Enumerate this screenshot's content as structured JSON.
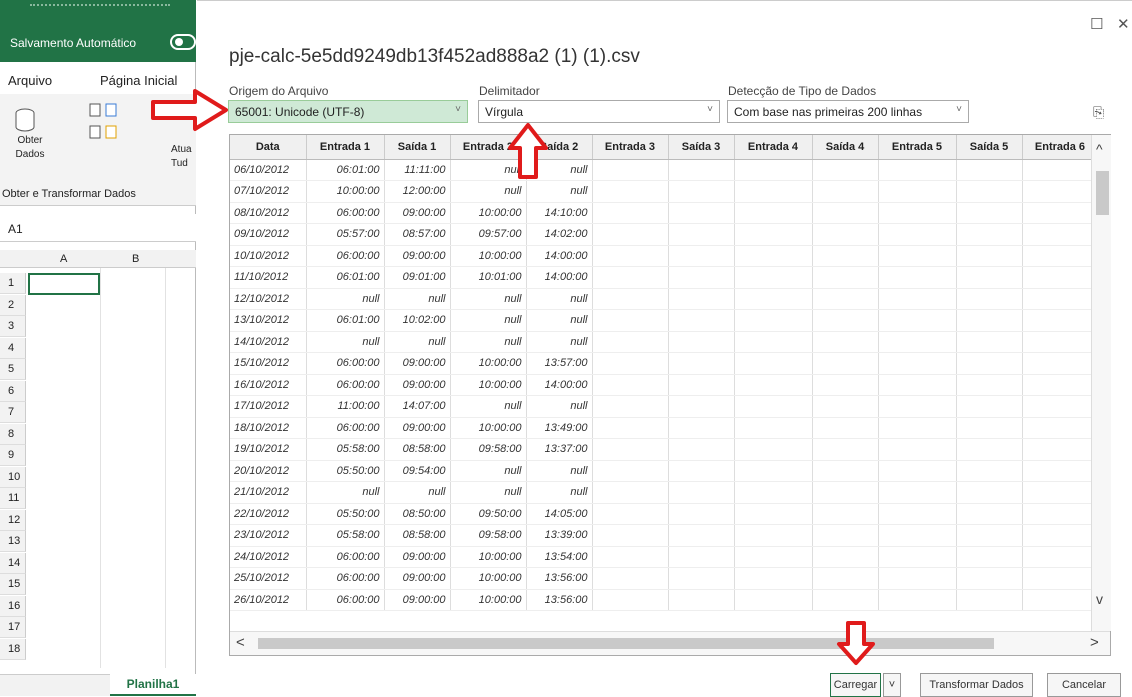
{
  "excel": {
    "autosave": "Salvamento Automático",
    "tabs": [
      "Arquivo",
      "Página Inicial"
    ],
    "obter_label": "Obter Dados",
    "atua_label": "Atua Tud",
    "group_label": "Obter e Transformar Dados",
    "name_box": "A1",
    "columns": [
      "A",
      "B"
    ],
    "rows": [
      "1",
      "2",
      "3",
      "4",
      "5",
      "6",
      "7",
      "8",
      "9",
      "10",
      "11",
      "12",
      "13",
      "14",
      "15",
      "16",
      "17",
      "18"
    ],
    "sheet": "Planilha1"
  },
  "dialog": {
    "title": "pje-calc-5e5dd9249db13f452ad888a2 (1) (1).csv",
    "origem_label": "Origem do Arquivo",
    "origem_value": "65001: Unicode (UTF-8)",
    "delim_label": "Delimitador",
    "delim_value": "Vírgula",
    "tipo_label": "Detecção de Tipo de Dados",
    "tipo_value": "Com base nas primeiras 200 linhas",
    "buttons": {
      "carregar": "Carregar",
      "transformar": "Transformar Dados",
      "cancelar": "Cancelar"
    }
  },
  "table": {
    "headers": [
      "Data",
      "Entrada 1",
      "Saída 1",
      "Entrada 2",
      "Saída 2",
      "Entrada 3",
      "Saída 3",
      "Entrada 4",
      "Saída 4",
      "Entrada 5",
      "Saída 5",
      "Entrada 6"
    ],
    "rows": [
      [
        "06/10/2012",
        "06:01:00",
        "11:11:00",
        "null",
        "null"
      ],
      [
        "07/10/2012",
        "10:00:00",
        "12:00:00",
        "null",
        "null"
      ],
      [
        "08/10/2012",
        "06:00:00",
        "09:00:00",
        "10:00:00",
        "14:10:00"
      ],
      [
        "09/10/2012",
        "05:57:00",
        "08:57:00",
        "09:57:00",
        "14:02:00"
      ],
      [
        "10/10/2012",
        "06:00:00",
        "09:00:00",
        "10:00:00",
        "14:00:00"
      ],
      [
        "11/10/2012",
        "06:01:00",
        "09:01:00",
        "10:01:00",
        "14:00:00"
      ],
      [
        "12/10/2012",
        "null",
        "null",
        "null",
        "null"
      ],
      [
        "13/10/2012",
        "06:01:00",
        "10:02:00",
        "null",
        "null"
      ],
      [
        "14/10/2012",
        "null",
        "null",
        "null",
        "null"
      ],
      [
        "15/10/2012",
        "06:00:00",
        "09:00:00",
        "10:00:00",
        "13:57:00"
      ],
      [
        "16/10/2012",
        "06:00:00",
        "09:00:00",
        "10:00:00",
        "14:00:00"
      ],
      [
        "17/10/2012",
        "11:00:00",
        "14:07:00",
        "null",
        "null"
      ],
      [
        "18/10/2012",
        "06:00:00",
        "09:00:00",
        "10:00:00",
        "13:49:00"
      ],
      [
        "19/10/2012",
        "05:58:00",
        "08:58:00",
        "09:58:00",
        "13:37:00"
      ],
      [
        "20/10/2012",
        "05:50:00",
        "09:54:00",
        "null",
        "null"
      ],
      [
        "21/10/2012",
        "null",
        "null",
        "null",
        "null"
      ],
      [
        "22/10/2012",
        "05:50:00",
        "08:50:00",
        "09:50:00",
        "14:05:00"
      ],
      [
        "23/10/2012",
        "05:58:00",
        "08:58:00",
        "09:58:00",
        "13:39:00"
      ],
      [
        "24/10/2012",
        "06:00:00",
        "09:00:00",
        "10:00:00",
        "13:54:00"
      ],
      [
        "25/10/2012",
        "06:00:00",
        "09:00:00",
        "10:00:00",
        "13:56:00"
      ],
      [
        "26/10/2012",
        "06:00:00",
        "09:00:00",
        "10:00:00",
        "13:56:00"
      ]
    ]
  },
  "colors": {
    "excel_green": "#217346",
    "arrow_red": "#e01b1b"
  }
}
